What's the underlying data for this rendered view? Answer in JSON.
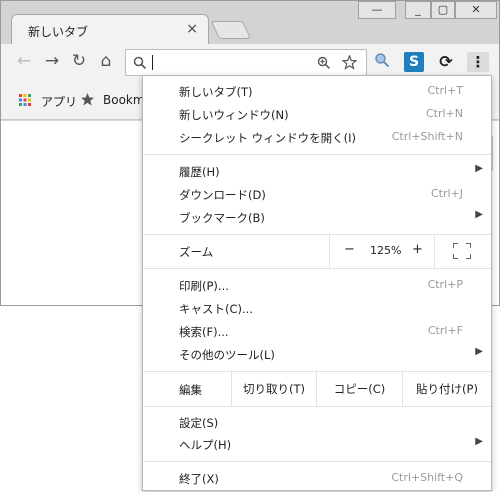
{
  "tab": {
    "title": "新しいタブ",
    "close": "×"
  },
  "window_controls": {
    "minimize": "—",
    "maximize": "▢",
    "close": "✕"
  },
  "toolbar": {
    "back": "←",
    "forward": "→",
    "reload": "↻",
    "home": "⌂",
    "omnibox_value": "",
    "omnibox_placeholder": "",
    "menu": "⋮"
  },
  "bookmarks": {
    "apps": "アプリ",
    "bookmarks": "Bookma"
  },
  "menu": {
    "items_top": [
      {
        "label": "新しいタブ(T)",
        "shortcut": "Ctrl+T"
      },
      {
        "label": "新しいウィンドウ(N)",
        "shortcut": "Ctrl+N"
      },
      {
        "label": "シークレット ウィンドウを開く(I)",
        "shortcut": "Ctrl+Shift+N"
      }
    ],
    "items_history": [
      {
        "label": "履歴(H)",
        "shortcut": "",
        "arrow": "▶"
      },
      {
        "label": "ダウンロード(D)",
        "shortcut": "Ctrl+J",
        "arrow": ""
      },
      {
        "label": "ブックマーク(B)",
        "shortcut": "",
        "arrow": "▶"
      }
    ],
    "zoom": {
      "label": "ズーム",
      "minus": "−",
      "value": "125%",
      "plus": "+"
    },
    "items_tools": [
      {
        "label": "印刷(P)...",
        "shortcut": "Ctrl+P",
        "arrow": ""
      },
      {
        "label": "キャスト(C)...",
        "shortcut": "",
        "arrow": ""
      },
      {
        "label": "検索(F)...",
        "shortcut": "Ctrl+F",
        "arrow": ""
      },
      {
        "label": "その他のツール(L)",
        "shortcut": "",
        "arrow": "▶"
      }
    ],
    "edit": {
      "label": "編集",
      "cut": "切り取り(T)",
      "copy": "コピー(C)",
      "paste": "貼り付け(P)"
    },
    "items_settings": [
      {
        "label": "設定(S)",
        "shortcut": "",
        "arrow": ""
      },
      {
        "label": "ヘルプ(H)",
        "shortcut": "",
        "arrow": "▶"
      }
    ],
    "exit": {
      "label": "終了(X)",
      "shortcut": "Ctrl+Shift+Q"
    }
  }
}
